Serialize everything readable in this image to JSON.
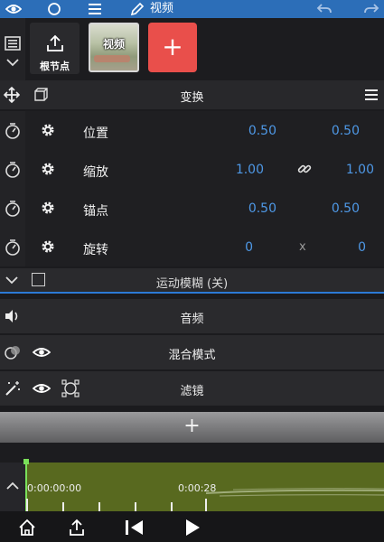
{
  "topbar": {
    "title": "视频",
    "icons": [
      "eye-icon",
      "circle-icon",
      "menu-icon",
      "pencil-icon",
      "undo-icon",
      "redo-icon"
    ],
    "color": "#2c6eb8"
  },
  "layers": {
    "parent_label": "根节点",
    "clip_label": "视频",
    "add_label": "+",
    "add_color": "#e94f4b"
  },
  "transform": {
    "title": "变换",
    "rows": [
      {
        "name": "位置",
        "v1": "0.50",
        "mid": "",
        "v2": "0.50"
      },
      {
        "name": "缩放",
        "v1": "1.00",
        "mid": "",
        "v2": "1.00"
      },
      {
        "name": "锚点",
        "v1": "0.50",
        "mid": "",
        "v2": "0.50"
      },
      {
        "name": "旋转",
        "v1": "0",
        "mid": "x",
        "v2": "0"
      }
    ],
    "value_color": "#4e98e6"
  },
  "motion_blur": {
    "title": "运动模糊 (关)"
  },
  "sections": {
    "audio": "音频",
    "blend": "混合模式",
    "filter": "滤镜"
  },
  "add_bar": {
    "label": "+"
  },
  "timeline": {
    "start_time": "0:00:00:00",
    "mark_time": "0:00:28",
    "track_color": "#58691f"
  }
}
